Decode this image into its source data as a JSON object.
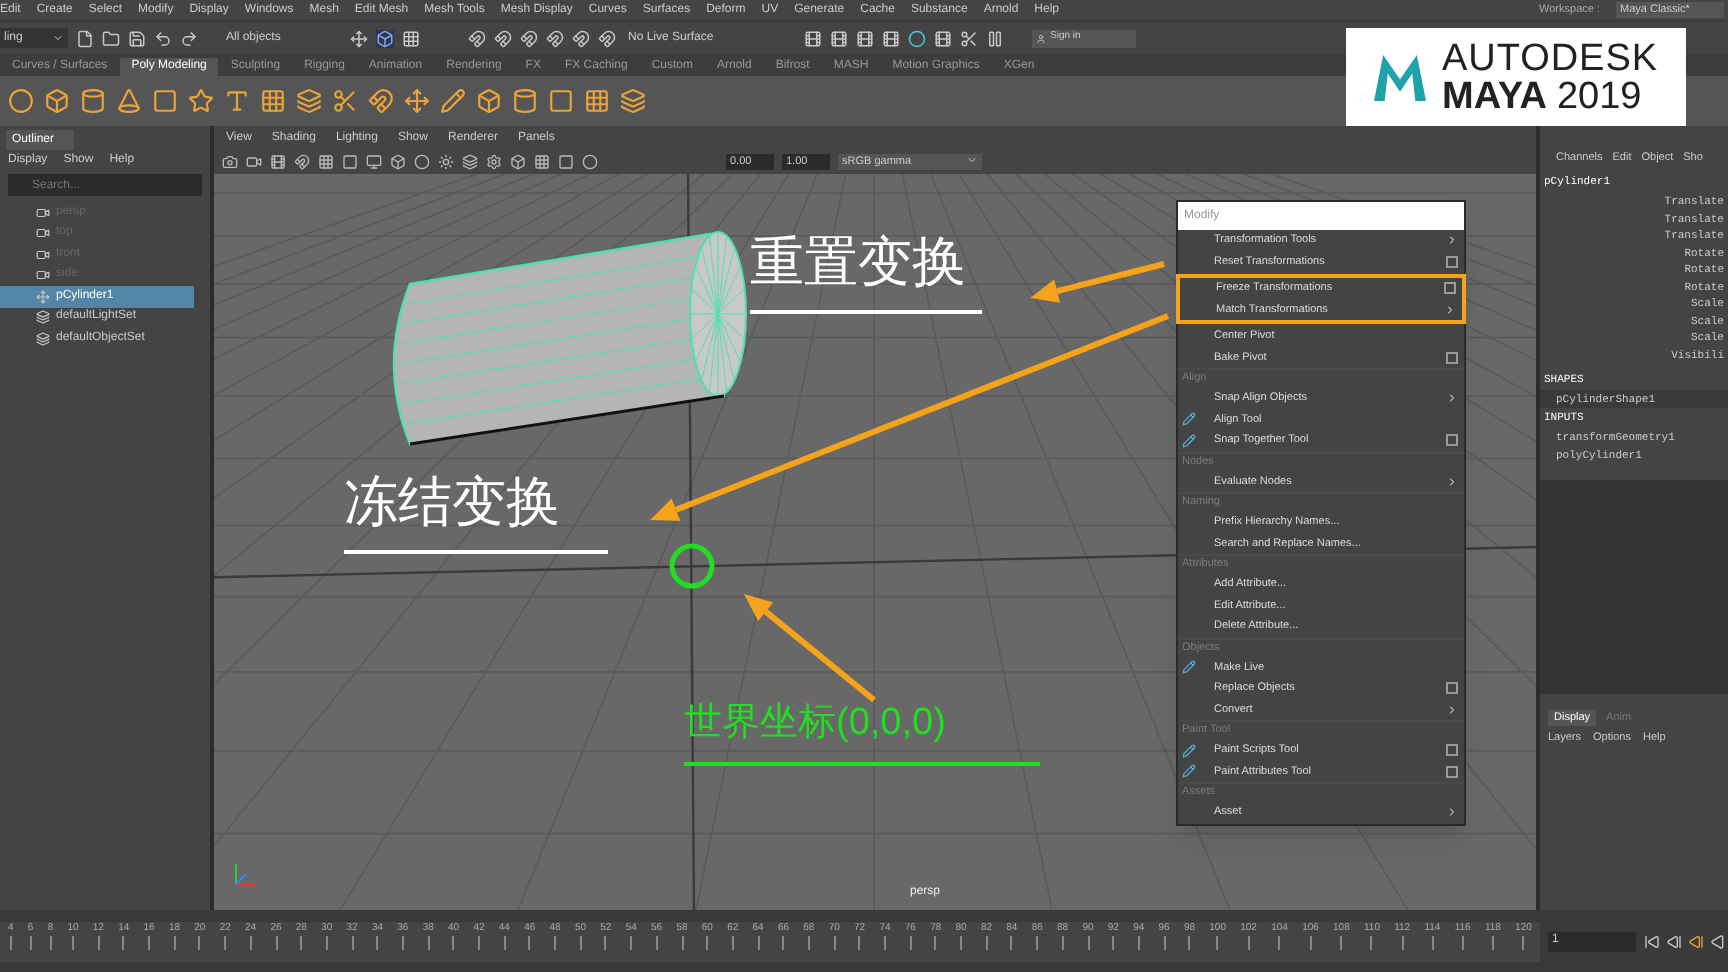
{
  "menubar": {
    "items": [
      "Edit",
      "Create",
      "Select",
      "Modify",
      "Display",
      "Windows",
      "Mesh",
      "Edit Mesh",
      "Mesh Tools",
      "Mesh Display",
      "Curves",
      "Surfaces",
      "Deform",
      "UV",
      "Generate",
      "Cache",
      "Substance",
      "Arnold",
      "Help"
    ],
    "workspace_label": "Workspace :",
    "workspace_value": "Maya Classic*"
  },
  "status_line": {
    "mode": "ling",
    "selection_mask": "All objects",
    "live_surface": "No Live Surface",
    "sign_in": "Sign in"
  },
  "shelf": {
    "tabs": [
      {
        "label": "Curves / Surfaces",
        "selected": false
      },
      {
        "label": "Poly Modeling",
        "selected": true
      },
      {
        "label": "Sculpting",
        "selected": false
      },
      {
        "label": "Rigging",
        "selected": false
      },
      {
        "label": "Animation",
        "selected": false
      },
      {
        "label": "Rendering",
        "selected": false
      },
      {
        "label": "FX",
        "selected": false
      },
      {
        "label": "FX Caching",
        "selected": false
      },
      {
        "label": "Custom",
        "selected": false
      },
      {
        "label": "Arnold",
        "selected": false
      },
      {
        "label": "Bifrost",
        "selected": false
      },
      {
        "label": "MASH",
        "selected": false
      },
      {
        "label": "Motion Graphics",
        "selected": false
      },
      {
        "label": "XGen",
        "selected": false
      }
    ]
  },
  "logo": {
    "brand": "AUTODESK",
    "product": "MAYA",
    "version": "2019"
  },
  "outliner": {
    "title": "Outliner",
    "menu": [
      "Display",
      "Show",
      "Help"
    ],
    "search": {
      "placeholder": "Search..."
    },
    "items": [
      {
        "label": "persp",
        "kind": "camera",
        "dimmed": true,
        "selected": false
      },
      {
        "label": "top",
        "kind": "camera",
        "dimmed": true,
        "selected": false
      },
      {
        "label": "front",
        "kind": "camera",
        "dimmed": true,
        "selected": false
      },
      {
        "label": "side",
        "kind": "camera",
        "dimmed": true,
        "selected": false
      },
      {
        "label": "pCylinder1",
        "kind": "mesh",
        "dimmed": false,
        "selected": true
      },
      {
        "label": "defaultLightSet",
        "kind": "set",
        "dimmed": false,
        "selected": false
      },
      {
        "label": "defaultObjectSet",
        "kind": "set",
        "dimmed": false,
        "selected": false
      }
    ]
  },
  "viewport": {
    "menu": [
      "View",
      "Shading",
      "Lighting",
      "Show",
      "Renderer",
      "Panels"
    ],
    "fields": [
      "0.00",
      "1.00"
    ],
    "color_space": "sRGB gamma",
    "camera_label": "persp"
  },
  "annotations": [
    {
      "text": "重置变换",
      "color": "#ffffff"
    },
    {
      "text": "冻结变换",
      "color": "#ffffff"
    },
    {
      "text": "世界坐标(0,0,0)",
      "color": "#22dd22"
    }
  ],
  "modify_menu": {
    "title": "Modify",
    "entries": [
      {
        "kind": "item",
        "label": "Transformation Tools",
        "submenu": true
      },
      {
        "kind": "item",
        "label": "Reset Transformations",
        "option_box": true
      },
      {
        "kind": "item",
        "label": "Freeze Transformations",
        "option_box": true,
        "highlighted": true
      },
      {
        "kind": "item",
        "label": "Match Transformations",
        "submenu": true,
        "highlighted": true
      },
      {
        "kind": "item",
        "label": "Center Pivot"
      },
      {
        "kind": "item",
        "label": "Bake Pivot",
        "option_box": true
      },
      {
        "kind": "header",
        "label": "Align"
      },
      {
        "kind": "item",
        "label": "Snap Align Objects",
        "submenu": true
      },
      {
        "kind": "item",
        "label": "Align Tool",
        "icon": true
      },
      {
        "kind": "item",
        "label": "Snap Together Tool",
        "option_box": true,
        "icon": true
      },
      {
        "kind": "header",
        "label": "Nodes"
      },
      {
        "kind": "item",
        "label": "Evaluate Nodes",
        "submenu": true
      },
      {
        "kind": "header",
        "label": "Naming"
      },
      {
        "kind": "item",
        "label": "Prefix Hierarchy Names..."
      },
      {
        "kind": "item",
        "label": "Search and Replace Names..."
      },
      {
        "kind": "header",
        "label": "Attributes"
      },
      {
        "kind": "item",
        "label": "Add Attribute..."
      },
      {
        "kind": "item",
        "label": "Edit Attribute..."
      },
      {
        "kind": "item",
        "label": "Delete Attribute..."
      },
      {
        "kind": "header",
        "label": "Objects"
      },
      {
        "kind": "item",
        "label": "Make Live",
        "icon": true
      },
      {
        "kind": "item",
        "label": "Replace Objects",
        "option_box": true
      },
      {
        "kind": "item",
        "label": "Convert",
        "submenu": true
      },
      {
        "kind": "header",
        "label": "Paint Tool"
      },
      {
        "kind": "item",
        "label": "Paint Scripts Tool",
        "option_box": true,
        "icon": true
      },
      {
        "kind": "item",
        "label": "Paint Attributes Tool",
        "option_box": true,
        "icon": true
      },
      {
        "kind": "header",
        "label": "Assets"
      },
      {
        "kind": "item",
        "label": "Asset",
        "submenu": true
      }
    ]
  },
  "channel_box": {
    "menu": [
      "Channels",
      "Edit",
      "Object",
      "Sho"
    ],
    "node": "pCylinder1",
    "attributes": [
      "Translate",
      "Translate",
      "Translate",
      "Rotate",
      "Rotate",
      "Rotate",
      "Scale",
      "Scale",
      "Scale",
      "Visibili"
    ],
    "shapes_header": "SHAPES",
    "shapes": [
      "pCylinderShape1"
    ],
    "inputs_header": "INPUTS",
    "inputs": [
      "transformGeometry1",
      "polyCylinder1"
    ]
  },
  "layer_editor": {
    "tabs": [
      {
        "label": "Display",
        "selected": true
      },
      {
        "label": "Anim",
        "selected": false
      }
    ],
    "menu": [
      "Layers",
      "Options",
      "Help"
    ]
  },
  "timeline": {
    "ticks": [
      "4",
      "6",
      "8",
      "10",
      "12",
      "14",
      "16",
      "18",
      "20",
      "22",
      "24",
      "26",
      "28",
      "30",
      "32",
      "34",
      "36",
      "38",
      "40",
      "42",
      "44",
      "46",
      "48",
      "50",
      "52",
      "54",
      "56",
      "58",
      "60",
      "62",
      "64",
      "66",
      "68",
      "70",
      "72",
      "74",
      "76",
      "78",
      "80",
      "82",
      "84",
      "86",
      "88",
      "90",
      "92",
      "94",
      "96",
      "98",
      "100",
      "102",
      "104",
      "106",
      "108",
      "110",
      "112",
      "114",
      "116",
      "118",
      "120"
    ],
    "current_frame": "1"
  }
}
